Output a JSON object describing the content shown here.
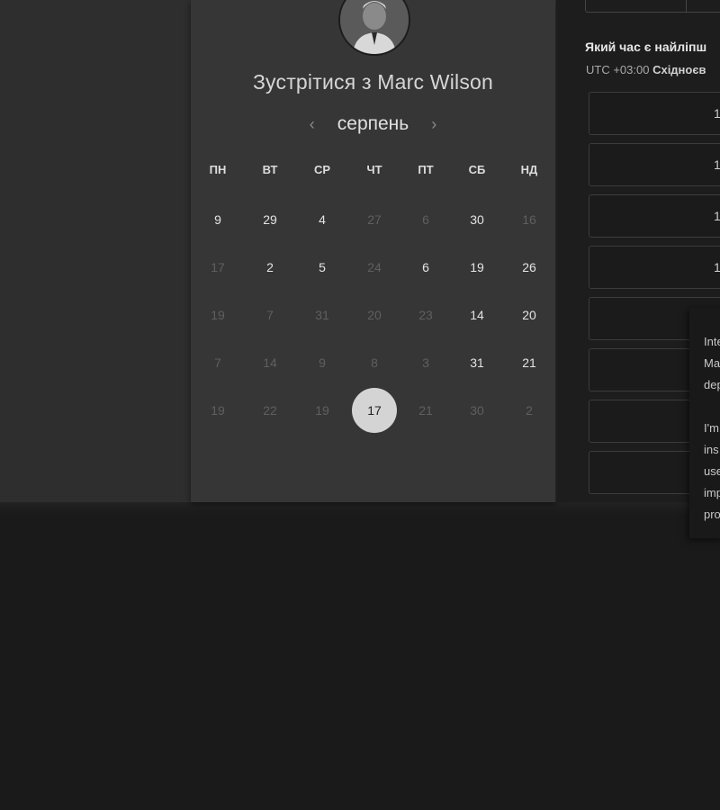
{
  "scheduler": {
    "title": "Зустрітися з Marc Wilson",
    "month": "серпень",
    "prev_icon": "‹",
    "next_icon": "›",
    "weekdays": [
      "ПН",
      "ВТ",
      "СР",
      "ЧТ",
      "ПТ",
      "СБ",
      "НД"
    ],
    "days": [
      [
        {
          "d": "9",
          "a": true
        },
        {
          "d": "29",
          "a": true
        },
        {
          "d": "4",
          "a": true
        },
        {
          "d": "27",
          "a": false
        },
        {
          "d": "6",
          "a": false
        },
        {
          "d": "30",
          "a": true
        },
        {
          "d": "16",
          "a": false
        }
      ],
      [
        {
          "d": "17",
          "a": false
        },
        {
          "d": "2",
          "a": true
        },
        {
          "d": "5",
          "a": true
        },
        {
          "d": "24",
          "a": false
        },
        {
          "d": "6",
          "a": true
        },
        {
          "d": "19",
          "a": true
        },
        {
          "d": "26",
          "a": true
        }
      ],
      [
        {
          "d": "19",
          "a": false
        },
        {
          "d": "7",
          "a": false
        },
        {
          "d": "31",
          "a": false
        },
        {
          "d": "20",
          "a": false
        },
        {
          "d": "23",
          "a": false
        },
        {
          "d": "14",
          "a": true
        },
        {
          "d": "20",
          "a": true
        }
      ],
      [
        {
          "d": "7",
          "a": false
        },
        {
          "d": "14",
          "a": false
        },
        {
          "d": "9",
          "a": false
        },
        {
          "d": "8",
          "a": false
        },
        {
          "d": "3",
          "a": false
        },
        {
          "d": "31",
          "a": true
        },
        {
          "d": "21",
          "a": true
        }
      ],
      [
        {
          "d": "19",
          "a": false
        },
        {
          "d": "22",
          "a": false
        },
        {
          "d": "19",
          "a": false
        },
        {
          "d": "17",
          "a": true,
          "selected": true
        },
        {
          "d": "21",
          "a": false
        },
        {
          "d": "30",
          "a": false
        },
        {
          "d": "2",
          "a": false
        }
      ]
    ]
  },
  "time_panel": {
    "question": "Який час є найліпш",
    "tz_offset": "UTC +03:00",
    "tz_name": "Східноєв",
    "slots": [
      "1",
      "1",
      "1",
      "1",
      "",
      "",
      "",
      ""
    ]
  },
  "tooltip": {
    "lines": [
      "Inte",
      "Ma",
      "dep",
      "",
      "I'm",
      "ins",
      "use",
      "imp",
      "pro"
    ]
  },
  "colors": {
    "background": "#1a1a1a",
    "card": "#363636",
    "selected_day": "#d4d4d4"
  }
}
